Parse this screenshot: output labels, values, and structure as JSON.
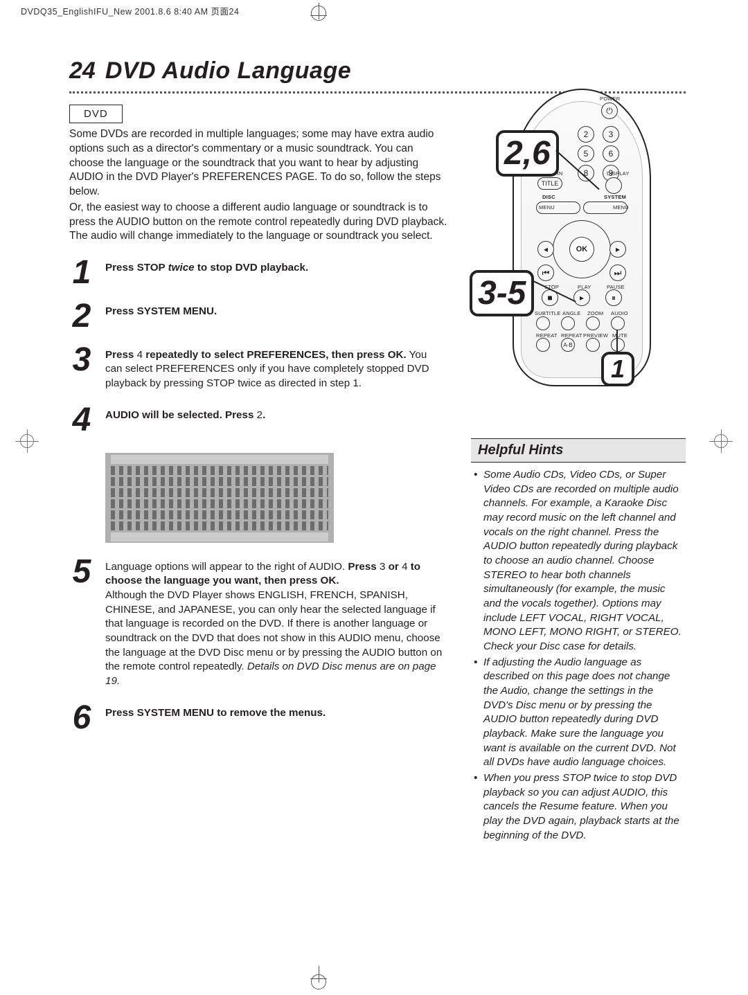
{
  "header_bar": "DVDQ35_EnglishIFU_New  2001.8.6  8:40 AM  页面24",
  "page": {
    "number": "24",
    "title": "DVD Audio Language"
  },
  "dvd_label": "DVD",
  "intro_p1": "Some DVDs are recorded in multiple languages; some may have extra audio options such as a director's commentary or a music soundtrack. You can choose the language or the soundtrack that you want to hear by adjusting AUDIO in the DVD Player's PREFERENCES PAGE. To do so, follow the steps below.",
  "intro_p2": "Or, the easiest way to choose a different audio language or soundtrack is to press the AUDIO button on the remote control repeatedly during DVD playback. The audio will change immediately to the language or soundtrack you select.",
  "steps": {
    "s1": {
      "num": "1",
      "text_a": "Press STOP ",
      "text_i": "twice",
      "text_b": " to stop DVD playback."
    },
    "s2": {
      "num": "2",
      "text": "Press SYSTEM MENU."
    },
    "s3": {
      "num": "3",
      "l1_a": "Press ",
      "l1_n1": "4",
      "l1_b": "  repeatedly to select PREFERENCES, then press OK.",
      "l2": " You can select PREFERENCES only if you have completely stopped DVD playback by pressing STOP twice as directed in step 1."
    },
    "s4": {
      "num": "4",
      "l1_a": "AUDIO will be selected. Press ",
      "l1_n": "2",
      "l1_b": "."
    },
    "s5": {
      "num": "5",
      "l1_a": "Language options will appear to the right of AUDIO. ",
      "l1_b": "Press ",
      "l1_n1": "3",
      "l1_c": " or ",
      "l1_n2": "4",
      "l1_d": " to choose the language you want, then press OK.",
      "l2": "Although the DVD Player shows ENGLISH, FRENCH, SPANISH, CHINESE, and JAPANESE, you can only hear the selected language if that language is recorded on the DVD. If there is another language or soundtrack on the DVD that does not show in this AUDIO menu, choose the language at the DVD Disc menu or by pressing the AUDIO button on the remote control repeatedly. ",
      "l2_i": "Details on DVD Disc menus are on page 19."
    },
    "s6": {
      "num": "6",
      "text": "Press SYSTEM MENU to remove the menus."
    }
  },
  "remote": {
    "power": "POWER",
    "nums": [
      "2",
      "3",
      "5",
      "6",
      "8",
      "9"
    ],
    "return": "RETURN",
    "display": "DISPLAY",
    "title": "TITLE",
    "disc": "DISC",
    "system": "SYSTEM",
    "menu": "MENU",
    "ok": "OK",
    "stop": "STOP",
    "play": "PLAY",
    "pause": "PAUSE",
    "row_a": [
      "SUBTITLE",
      "ANGLE",
      "ZOOM",
      "AUDIO"
    ],
    "row_b": [
      "REPEAT",
      "REPEAT",
      "PREVIEW",
      "MUTE"
    ],
    "ab": "A-B"
  },
  "callouts": {
    "top": "2,6",
    "mid": "3-5",
    "bot": "1"
  },
  "hints": {
    "title": "Helpful Hints",
    "b1": "Some Audio CDs, Video CDs, or Super Video CDs are recorded on multiple audio channels. For example, a Karaoke Disc may record music on the left channel and vocals on the right channel. Press the AUDIO button repeatedly during playback to choose an audio channel. Choose STEREO to hear both channels simultaneously (for example, the music and the vocals together). Options may include LEFT VOCAL, RIGHT VOCAL, MONO LEFT, MONO RIGHT, or STEREO. Check your Disc case for details.",
    "b2": "If adjusting the Audio language as described on this page does not change the Audio, change the settings in the DVD's Disc menu or by pressing the AUDIO button repeatedly during DVD playback. Make sure the language you want is available on the current DVD. Not all DVDs have audio language choices.",
    "b3": "When you press STOP twice to stop DVD playback so you can adjust AUDIO, this cancels the Resume feature. When you play the DVD again, playback starts at the beginning of the DVD."
  }
}
